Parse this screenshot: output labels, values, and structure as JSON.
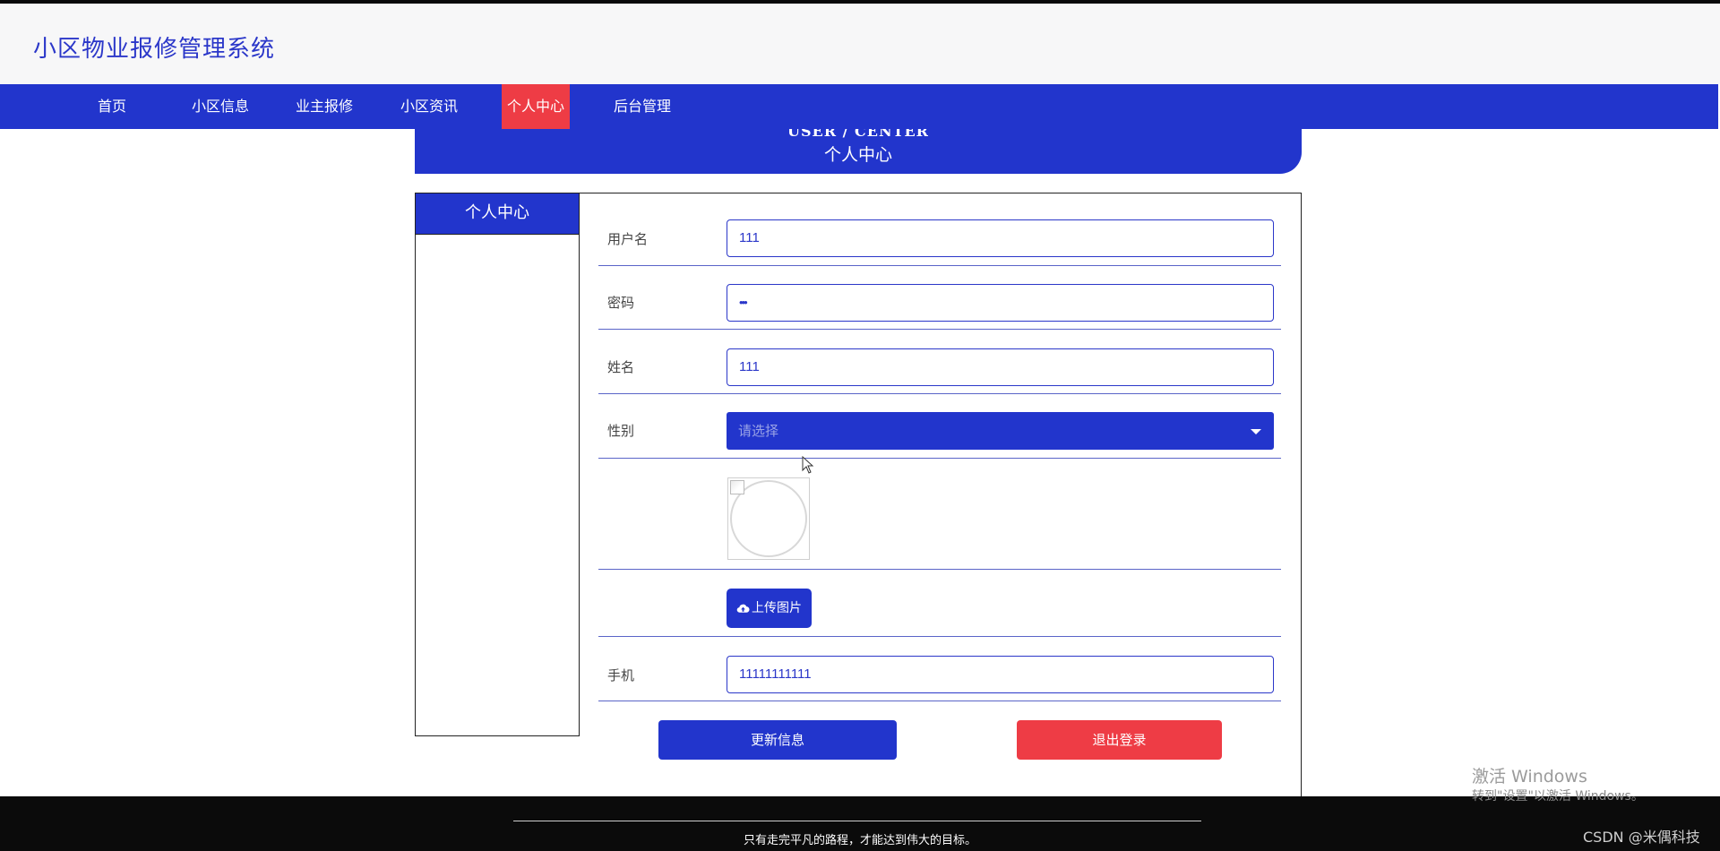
{
  "header": {
    "title": "小区物业报修管理系统"
  },
  "nav": {
    "items": [
      {
        "label": "首页"
      },
      {
        "label": "小区信息"
      },
      {
        "label": "业主报修"
      },
      {
        "label": "小区资讯"
      },
      {
        "label": "个人中心",
        "active": true
      },
      {
        "label": "后台管理"
      }
    ]
  },
  "banner": {
    "en": "USER / CENTER",
    "cn": "个人中心"
  },
  "sidebar": {
    "title": "个人中心"
  },
  "form": {
    "username": {
      "label": "用户名",
      "value": "111"
    },
    "password": {
      "label": "密码",
      "value": "•••"
    },
    "name": {
      "label": "姓名",
      "value": "111"
    },
    "gender": {
      "label": "性别",
      "placeholder": "请选择"
    },
    "upload_label": "上传图片",
    "phone": {
      "label": "手机",
      "value": "11111111111"
    },
    "update_label": "更新信息",
    "logout_label": "退出登录"
  },
  "footer": {
    "text": "只有走完平凡的路程，才能达到伟大的目标。"
  },
  "overlay": {
    "activate_title": "激活 Windows",
    "activate_sub": "转到\"设置\"以激活 Windows。",
    "csdn": "CSDN @米偶科技"
  },
  "colors": {
    "primary": "#2235cc",
    "danger": "#ee3c45",
    "footer": "#0b0b0b"
  },
  "icons": {
    "upload": "cloud-upload-icon",
    "dropdown": "caret-down-icon",
    "avatar": "broken-image-icon"
  }
}
